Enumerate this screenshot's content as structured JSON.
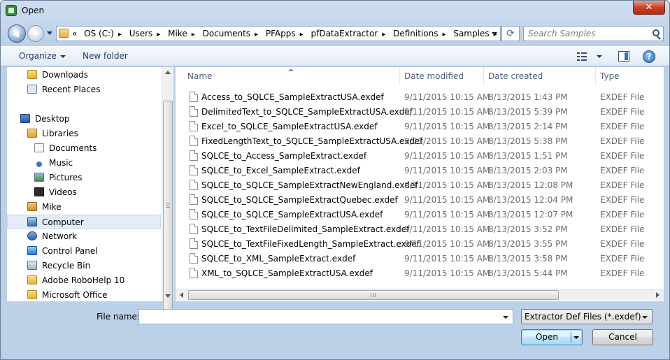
{
  "window": {
    "title": "Open",
    "close_label": "✕"
  },
  "address": {
    "overflow": "«",
    "crumbs": [
      "OS (C:)",
      "Users",
      "Mike",
      "Documents",
      "PFApps",
      "pfDataExtractor",
      "Definitions",
      "Samples"
    ],
    "separator": "▸"
  },
  "search": {
    "placeholder": "Search Samples"
  },
  "toolbar": {
    "organize_label": "Organize",
    "new_folder_label": "New folder",
    "help_label": "?"
  },
  "nav": {
    "items": [
      {
        "label": "Downloads",
        "icon": "downloads-folder-icon"
      },
      {
        "label": "Recent Places",
        "icon": "recent-places-icon"
      },
      {
        "label": "Desktop",
        "icon": "desktop-icon"
      },
      {
        "label": "Libraries",
        "icon": "libraries-icon"
      },
      {
        "label": "Documents",
        "icon": "documents-library-icon"
      },
      {
        "label": "Music",
        "icon": "music-library-icon"
      },
      {
        "label": "Pictures",
        "icon": "pictures-library-icon"
      },
      {
        "label": "Videos",
        "icon": "videos-library-icon"
      },
      {
        "label": "Mike",
        "icon": "user-folder-icon"
      },
      {
        "label": "Computer",
        "icon": "computer-icon",
        "selected": true
      },
      {
        "label": "Network",
        "icon": "network-icon"
      },
      {
        "label": "Control Panel",
        "icon": "control-panel-icon"
      },
      {
        "label": "Recycle Bin",
        "icon": "recycle-bin-icon"
      },
      {
        "label": "Adobe RoboHelp 10",
        "icon": "folder-icon"
      },
      {
        "label": "Microsoft Office",
        "icon": "folder-icon"
      }
    ]
  },
  "columns": {
    "name": "Name",
    "modified": "Date modified",
    "created": "Date created",
    "type": "Type"
  },
  "files": [
    {
      "name": "Access_to_SQLCE_SampleExtractUSA.exdef",
      "modified": "9/11/2015 10:15 AM",
      "created": "8/13/2015 1:43 PM",
      "type": "EXDEF File"
    },
    {
      "name": "DelimitedText_to_SQLCE_SampleExtractUSA.exdef",
      "modified": "9/11/2015 10:15 AM",
      "created": "8/13/2015 5:39 PM",
      "type": "EXDEF File"
    },
    {
      "name": "Excel_to_SQLCE_SampleExtractUSA.exdef",
      "modified": "9/11/2015 10:15 AM",
      "created": "8/13/2015 2:14 PM",
      "type": "EXDEF File"
    },
    {
      "name": "FixedLengthText_to_SQLCE_SampleExtractUSA.exdef",
      "modified": "9/11/2015 10:15 AM",
      "created": "8/13/2015 5:38 PM",
      "type": "EXDEF File"
    },
    {
      "name": "SQLCE_to_Access_SampleExtract.exdef",
      "modified": "9/11/2015 10:15 AM",
      "created": "8/13/2015 1:51 PM",
      "type": "EXDEF File"
    },
    {
      "name": "SQLCE_to_Excel_SampleExtract.exdef",
      "modified": "9/11/2015 10:15 AM",
      "created": "8/13/2015 2:03 PM",
      "type": "EXDEF File"
    },
    {
      "name": "SQLCE_to_SQLCE_SampleExtractNewEngland.exdef",
      "modified": "9/11/2015 10:15 AM",
      "created": "8/13/2015 12:08 PM",
      "type": "EXDEF File"
    },
    {
      "name": "SQLCE_to_SQLCE_SampleExtractQuebec.exdef",
      "modified": "9/11/2015 10:15 AM",
      "created": "8/13/2015 12:04 PM",
      "type": "EXDEF File"
    },
    {
      "name": "SQLCE_to_SQLCE_SampleExtractUSA.exdef",
      "modified": "9/11/2015 10:15 AM",
      "created": "8/13/2015 12:07 PM",
      "type": "EXDEF File"
    },
    {
      "name": "SQLCE_to_TextFileDelimited_SampleExtract.exdef",
      "modified": "9/11/2015 10:15 AM",
      "created": "8/13/2015 3:52 PM",
      "type": "EXDEF File"
    },
    {
      "name": "SQLCE_to_TextFileFixedLength_SampleExtract.exdef",
      "modified": "9/11/2015 10:15 AM",
      "created": "8/13/2015 3:55 PM",
      "type": "EXDEF File"
    },
    {
      "name": "SQLCE_to_XML_SampleExtract.exdef",
      "modified": "9/11/2015 10:15 AM",
      "created": "8/13/2015 3:58 PM",
      "type": "EXDEF File"
    },
    {
      "name": "XML_to_SQLCE_SampleExtractUSA.exdef",
      "modified": "9/11/2015 10:15 AM",
      "created": "8/13/2015 5:44 PM",
      "type": "EXDEF File"
    }
  ],
  "bottom": {
    "file_name_label": "File name:",
    "file_name_value": "",
    "filter_value": "Extractor Def Files (*.exdef)",
    "open_label": "Open",
    "cancel_label": "Cancel"
  }
}
